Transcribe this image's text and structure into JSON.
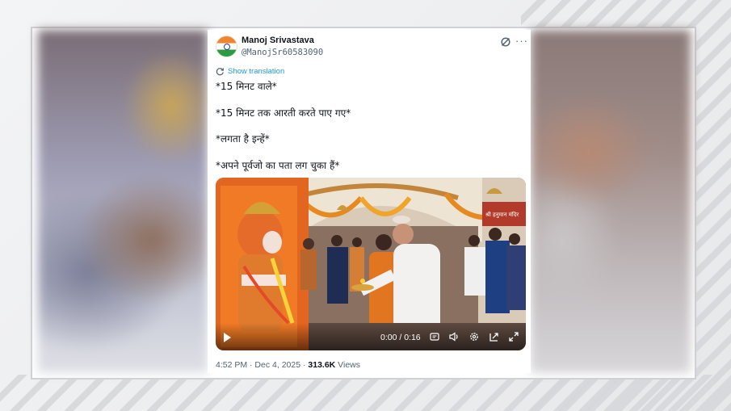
{
  "tweet": {
    "display_name": "Manoj Srivastava",
    "handle": "@ManojSr60583090",
    "show_translation": "Show translation",
    "lines": [
      "*15 मिनट वाले*",
      "*15 मिनट तक आरती करते पाए गए*",
      "*लगता है इन्हें*",
      "*अपने पूर्वजो का पता लग चुका हैं*"
    ],
    "video": {
      "time": "0:00 / 0:16",
      "sign_text": "श्री हनुमान मंदिर"
    },
    "timestamp": "4:52 PM · Dec 4, 2025 · ",
    "views_count": "313.6K",
    "views_label": " Views"
  },
  "colors": {
    "link": "#1d9bf0",
    "text": "#0f1419",
    "muted": "#536471"
  },
  "icons": [
    "grok-icon",
    "more-icon",
    "translate-icon",
    "play-icon",
    "captions-icon",
    "volume-icon",
    "settings-icon",
    "pip-icon",
    "fullscreen-icon"
  ]
}
